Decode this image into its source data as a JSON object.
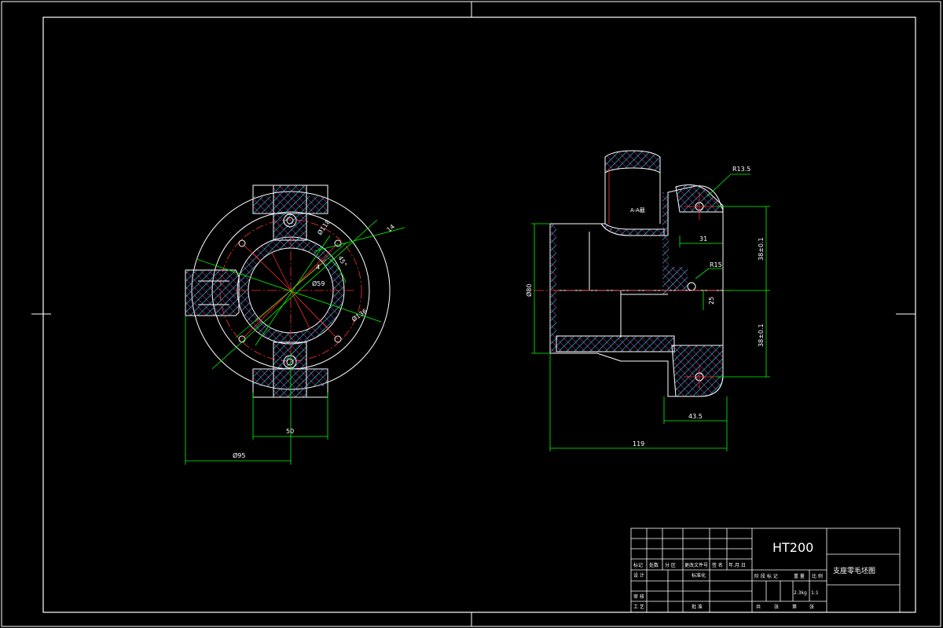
{
  "front_view": {
    "dims": {
      "d118": "Ø118",
      "d59": "Ø59",
      "d136": "Ø136",
      "four_holes": "4",
      "angle": "45°",
      "slot14": "14",
      "w50": "50",
      "d95": "Ø95"
    }
  },
  "side_view": {
    "section_label": "A-A截",
    "dims": {
      "r13_5": "R13.5",
      "r15": "R15",
      "d31": "31",
      "d25": "25",
      "d80": "Ø80",
      "d38a": "38±0.1",
      "d38b": "38±0.1",
      "d43_5": "43.5",
      "d119": "119"
    }
  },
  "title_block": {
    "material": "HT200",
    "part_name": "支座零毛坯图",
    "mass": "2.3kg",
    "scale": "1:1",
    "headers": [
      "标记",
      "处数",
      "分 区",
      "更改文件号",
      "签 名",
      "年.月.日"
    ],
    "row_labels": [
      "设 计",
      "审 核",
      "工 艺"
    ],
    "mid_labels": [
      "标准化",
      "批 准"
    ],
    "stage_labels": [
      "阶 段 标 记",
      "重 量",
      "比 例"
    ],
    "sheet_labels": [
      "共",
      "张",
      "第",
      "张"
    ]
  }
}
